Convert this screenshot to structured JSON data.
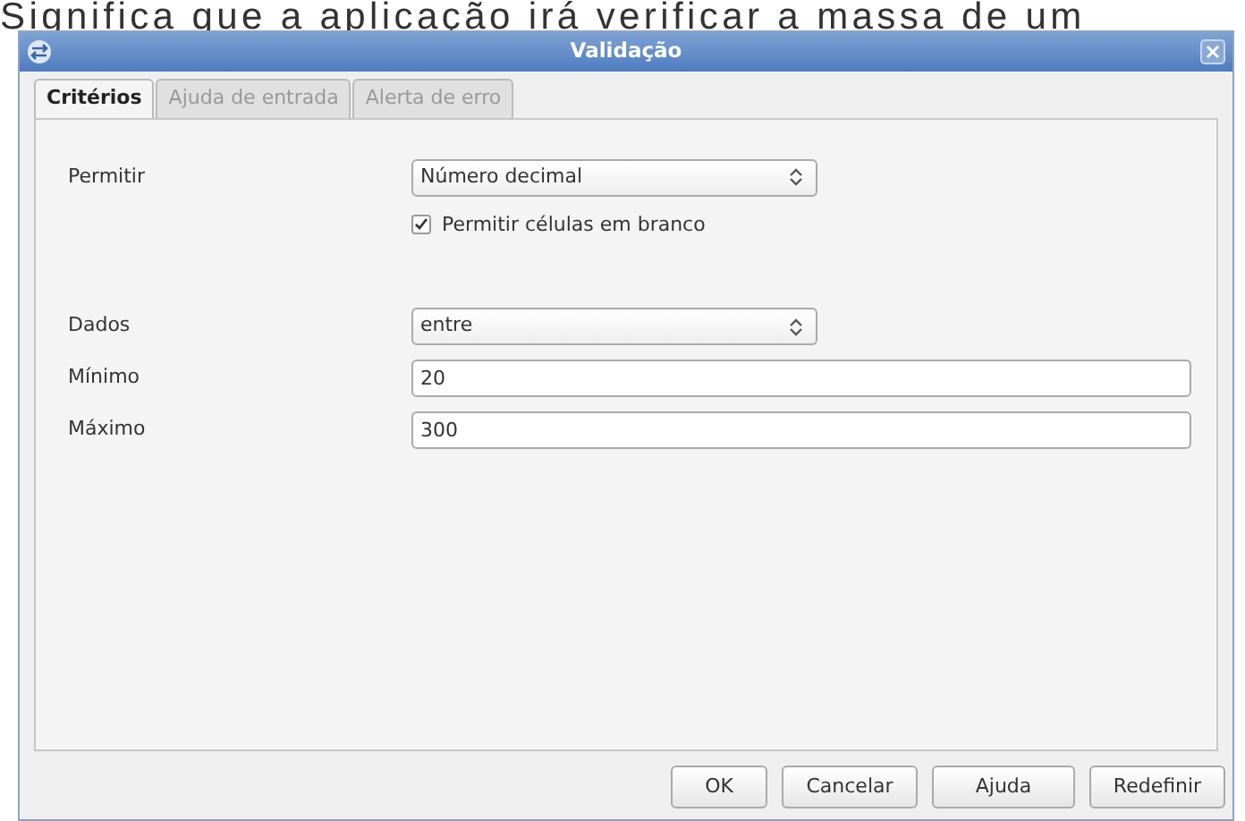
{
  "background_text": "Significa que a aplicação irá verificar a massa de um",
  "window": {
    "title": "Validação"
  },
  "tabs": [
    {
      "label": "Critérios",
      "selected": true
    },
    {
      "label": "Ajuda de entrada",
      "selected": false
    },
    {
      "label": "Alerta de erro",
      "selected": false
    }
  ],
  "fields": [
    {
      "kind": "select",
      "label": "Permitir",
      "value": "Número decimal"
    },
    {
      "kind": "checkbox",
      "label": "Permitir células em branco",
      "checked": true
    },
    {
      "kind": "select",
      "label": "Dados",
      "value": "entre"
    },
    {
      "kind": "text",
      "label": "Mínimo",
      "value": "20"
    },
    {
      "kind": "text",
      "label": "Máximo",
      "value": "300"
    }
  ],
  "buttons": [
    {
      "label": "OK"
    },
    {
      "label": "Cancelar"
    },
    {
      "label": "Ajuda"
    },
    {
      "label": "Redefinir"
    }
  ]
}
